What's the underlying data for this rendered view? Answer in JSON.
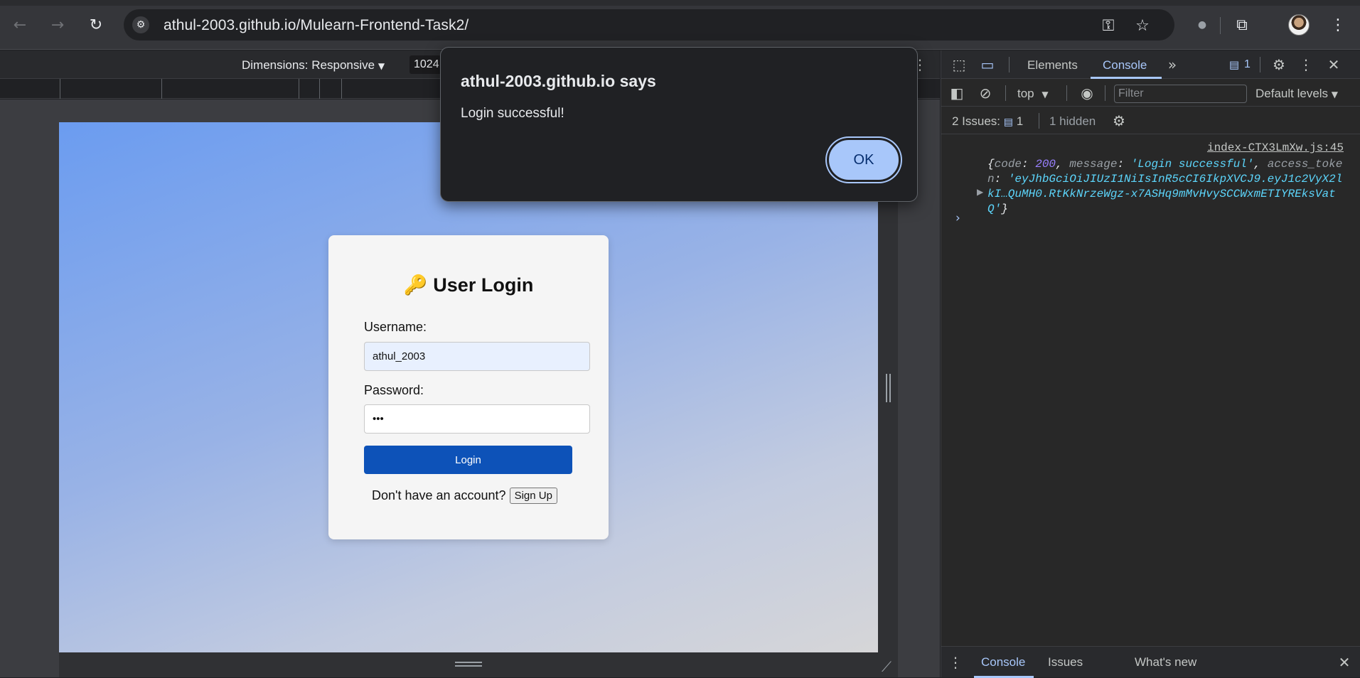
{
  "browser": {
    "url_host": "athul-2003.github.io",
    "url_path": "/Mulearn-Frontend-Task2/",
    "icons": [
      "back-icon",
      "forward-icon",
      "reload-icon",
      "site-info-icon",
      "password-key-icon",
      "bookmark-star-icon",
      "extension-puzzle-icon",
      "profile-avatar",
      "menu-dots-icon"
    ]
  },
  "device_toolbar": {
    "dimensions_label": "Dimensions: Responsive",
    "width_value": "1024"
  },
  "login": {
    "title_icon": "🔑",
    "title": "User Login",
    "username_label": "Username:",
    "username_value": "athul_2003",
    "password_label": "Password:",
    "password_value": "•••",
    "login_button": "Login",
    "signup_prompt": "Don't have an account?",
    "signup_button": "Sign Up"
  },
  "alert": {
    "title": "athul-2003.github.io says",
    "message": "Login successful!",
    "ok_button": "OK"
  },
  "devtools": {
    "tabs": [
      "Elements",
      "Console"
    ],
    "active_tab": "Console",
    "issues_badge": "1",
    "context": "top",
    "filter_placeholder": "Filter",
    "levels": "Default levels",
    "issues_label": "2 Issues:",
    "issues_count": "1",
    "hidden": "1 hidden",
    "log_source": "index-CTX3LmXw.js:45",
    "log": {
      "open": "{",
      "code_key": "code",
      "code_val": "200",
      "message_key": "message",
      "message_val": "'Login successful'",
      "token_key": "access_token",
      "token_val": "'eyJhbGciOiJIUzI1NiIsInR5cCI6IkpXVCJ9.eyJ1c2VyX2lkI…QuMH0.RtKkNrzeWgz-x7ASHq9mMvHvySCCWxmETIYREksVatQ'",
      "close": "}"
    },
    "drawer_tabs": [
      "Console",
      "Issues",
      "What's new"
    ]
  }
}
